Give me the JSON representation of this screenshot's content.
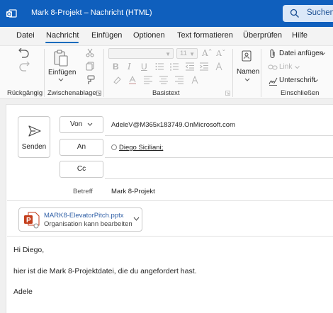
{
  "window": {
    "title": "Mark 8-Projekt – Nachricht (HTML)",
    "search_label": "Suchen"
  },
  "colors": {
    "titlebar": "#0f5fbd",
    "accent": "#0f6cbd",
    "powerpoint": "#c43e1c"
  },
  "tabs": [
    {
      "label": "Datei"
    },
    {
      "label": "Nachricht",
      "active": true
    },
    {
      "label": "Einfügen"
    },
    {
      "label": "Optionen"
    },
    {
      "label": "Text formatieren"
    },
    {
      "label": "Überprüfen"
    },
    {
      "label": "Hilfe"
    }
  ],
  "ribbon": {
    "groups": {
      "undo": "Rückgängig",
      "clipboard": "Zwischenablage",
      "basic_text": "Basistext",
      "include": "Einschließen"
    },
    "paste_label": "Einfügen",
    "font_size": "11",
    "names_label": "Namen",
    "attach_file": "Datei anfügen",
    "link": "Link",
    "signature": "Unterschrift"
  },
  "compose": {
    "send_label": "Senden",
    "from_label": "Von",
    "from_value": "AdeleV@M365x183749.OnMicrosoft.com",
    "to_label": "An",
    "to_value": "Diego Siciliani;",
    "cc_label": "Cc",
    "subject_label": "Betreff",
    "subject_value": "Mark 8-Projekt"
  },
  "attachment": {
    "name": "MARK8-ElevatorPitch.pptx",
    "permission": "Organisation kann bearbeiten",
    "icon": "powerpoint-file-icon"
  },
  "body": {
    "greeting": "Hi Diego,",
    "line1": "hier ist die Mark 8-Projektdatei, die du angefordert hast.",
    "signature": "Adele"
  }
}
